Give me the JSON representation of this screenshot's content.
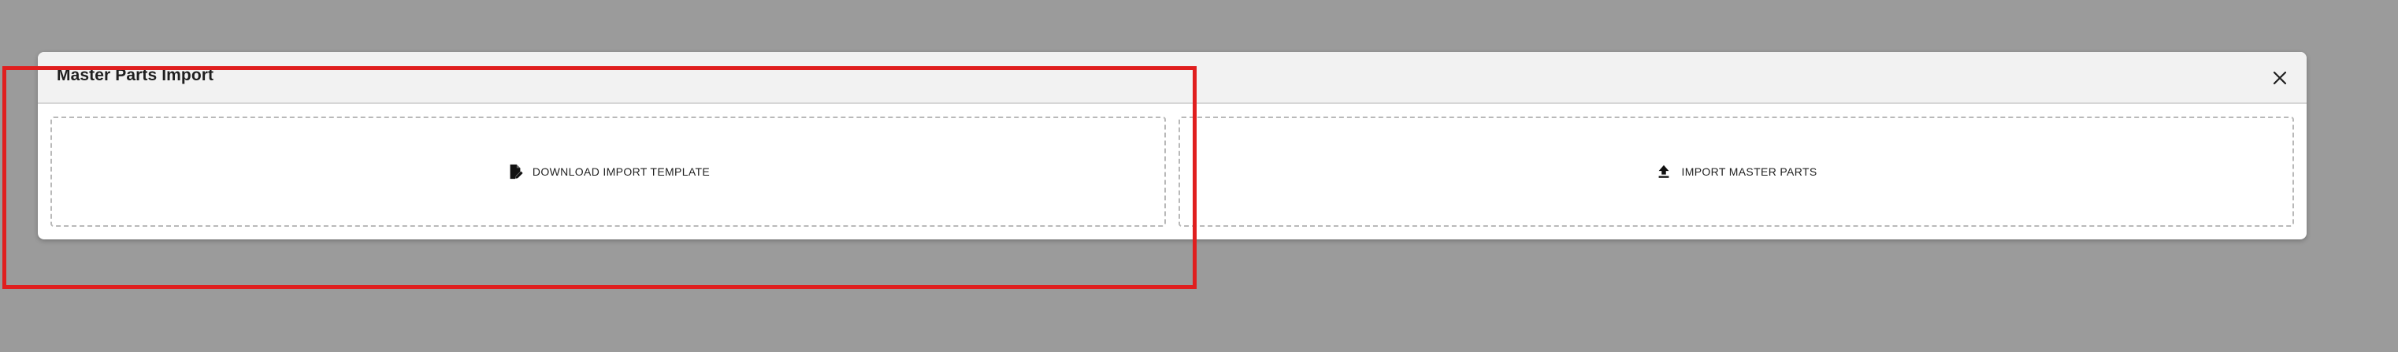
{
  "dialog": {
    "title": "Master Parts Import",
    "close_icon": "close-icon"
  },
  "actions": [
    {
      "label": "DOWNLOAD IMPORT TEMPLATE",
      "icon": "file-edit-icon"
    },
    {
      "label": "IMPORT MASTER PARTS",
      "icon": "upload-icon"
    }
  ],
  "colors": {
    "backdrop": "#9b9b9b",
    "header": "#f2f2f2",
    "panel_border": "#b9b9b9",
    "highlight": "#e01f1f"
  }
}
